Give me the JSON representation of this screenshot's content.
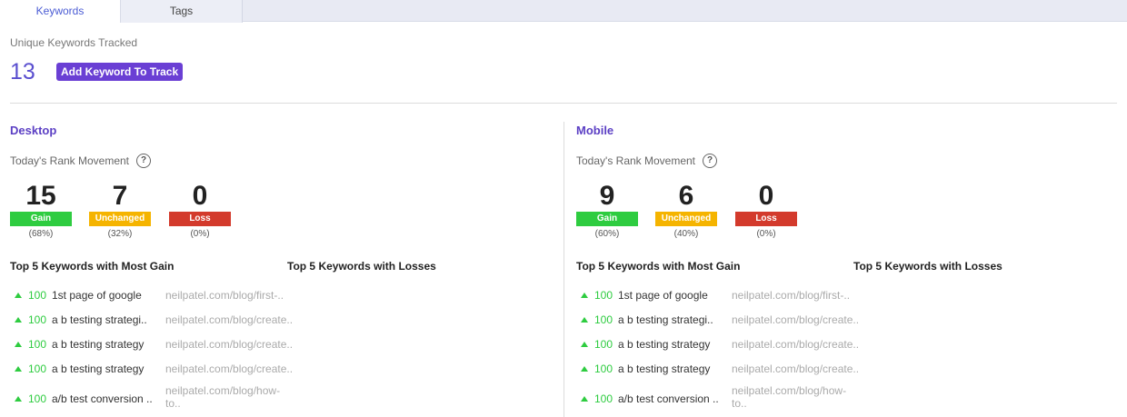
{
  "tabs": [
    {
      "label": "Keywords",
      "active": true
    },
    {
      "label": "Tags",
      "active": false
    }
  ],
  "summary": {
    "unique_label": "Unique Keywords Tracked",
    "unique_count": "13",
    "add_button": "Add Keyword To Track"
  },
  "colors": {
    "accent": "#6a3fd4",
    "gain": "#2ecc40",
    "unchanged": "#f5b400",
    "loss": "#d33a2c"
  },
  "desktop": {
    "title": "Desktop",
    "movement_label": "Today's Rank Movement",
    "help_icon": "?",
    "stats": [
      {
        "num": "15",
        "label": "Gain",
        "pct": "(68%)"
      },
      {
        "num": "7",
        "label": "Unchanged",
        "pct": "(32%)"
      },
      {
        "num": "0",
        "label": "Loss",
        "pct": "(0%)"
      }
    ],
    "gain_heading": "Top 5 Keywords with Most Gain",
    "loss_heading": "Top 5 Keywords with Losses",
    "keywords": [
      {
        "value": "100",
        "keyword": "1st page of google",
        "url": "neilpatel.com/blog/first-.."
      },
      {
        "value": "100",
        "keyword": "a b testing strategi..",
        "url": "neilpatel.com/blog/create.."
      },
      {
        "value": "100",
        "keyword": "a b testing strategy",
        "url": "neilpatel.com/blog/create.."
      },
      {
        "value": "100",
        "keyword": "a b testing strategy",
        "url": "neilpatel.com/blog/create.."
      },
      {
        "value": "100",
        "keyword": "a/b test conversion ..",
        "url": "neilpatel.com/blog/how-to.."
      }
    ]
  },
  "mobile": {
    "title": "Mobile",
    "movement_label": "Today's Rank Movement",
    "help_icon": "?",
    "stats": [
      {
        "num": "9",
        "label": "Gain",
        "pct": "(60%)"
      },
      {
        "num": "6",
        "label": "Unchanged",
        "pct": "(40%)"
      },
      {
        "num": "0",
        "label": "Loss",
        "pct": "(0%)"
      }
    ],
    "gain_heading": "Top 5 Keywords with Most Gain",
    "loss_heading": "Top 5 Keywords with Losses",
    "keywords": [
      {
        "value": "100",
        "keyword": "1st page of google",
        "url": "neilpatel.com/blog/first-.."
      },
      {
        "value": "100",
        "keyword": "a b testing strategi..",
        "url": "neilpatel.com/blog/create.."
      },
      {
        "value": "100",
        "keyword": "a b testing strategy",
        "url": "neilpatel.com/blog/create.."
      },
      {
        "value": "100",
        "keyword": "a b testing strategy",
        "url": "neilpatel.com/blog/create.."
      },
      {
        "value": "100",
        "keyword": "a/b test conversion ..",
        "url": "neilpatel.com/blog/how-to.."
      }
    ]
  }
}
